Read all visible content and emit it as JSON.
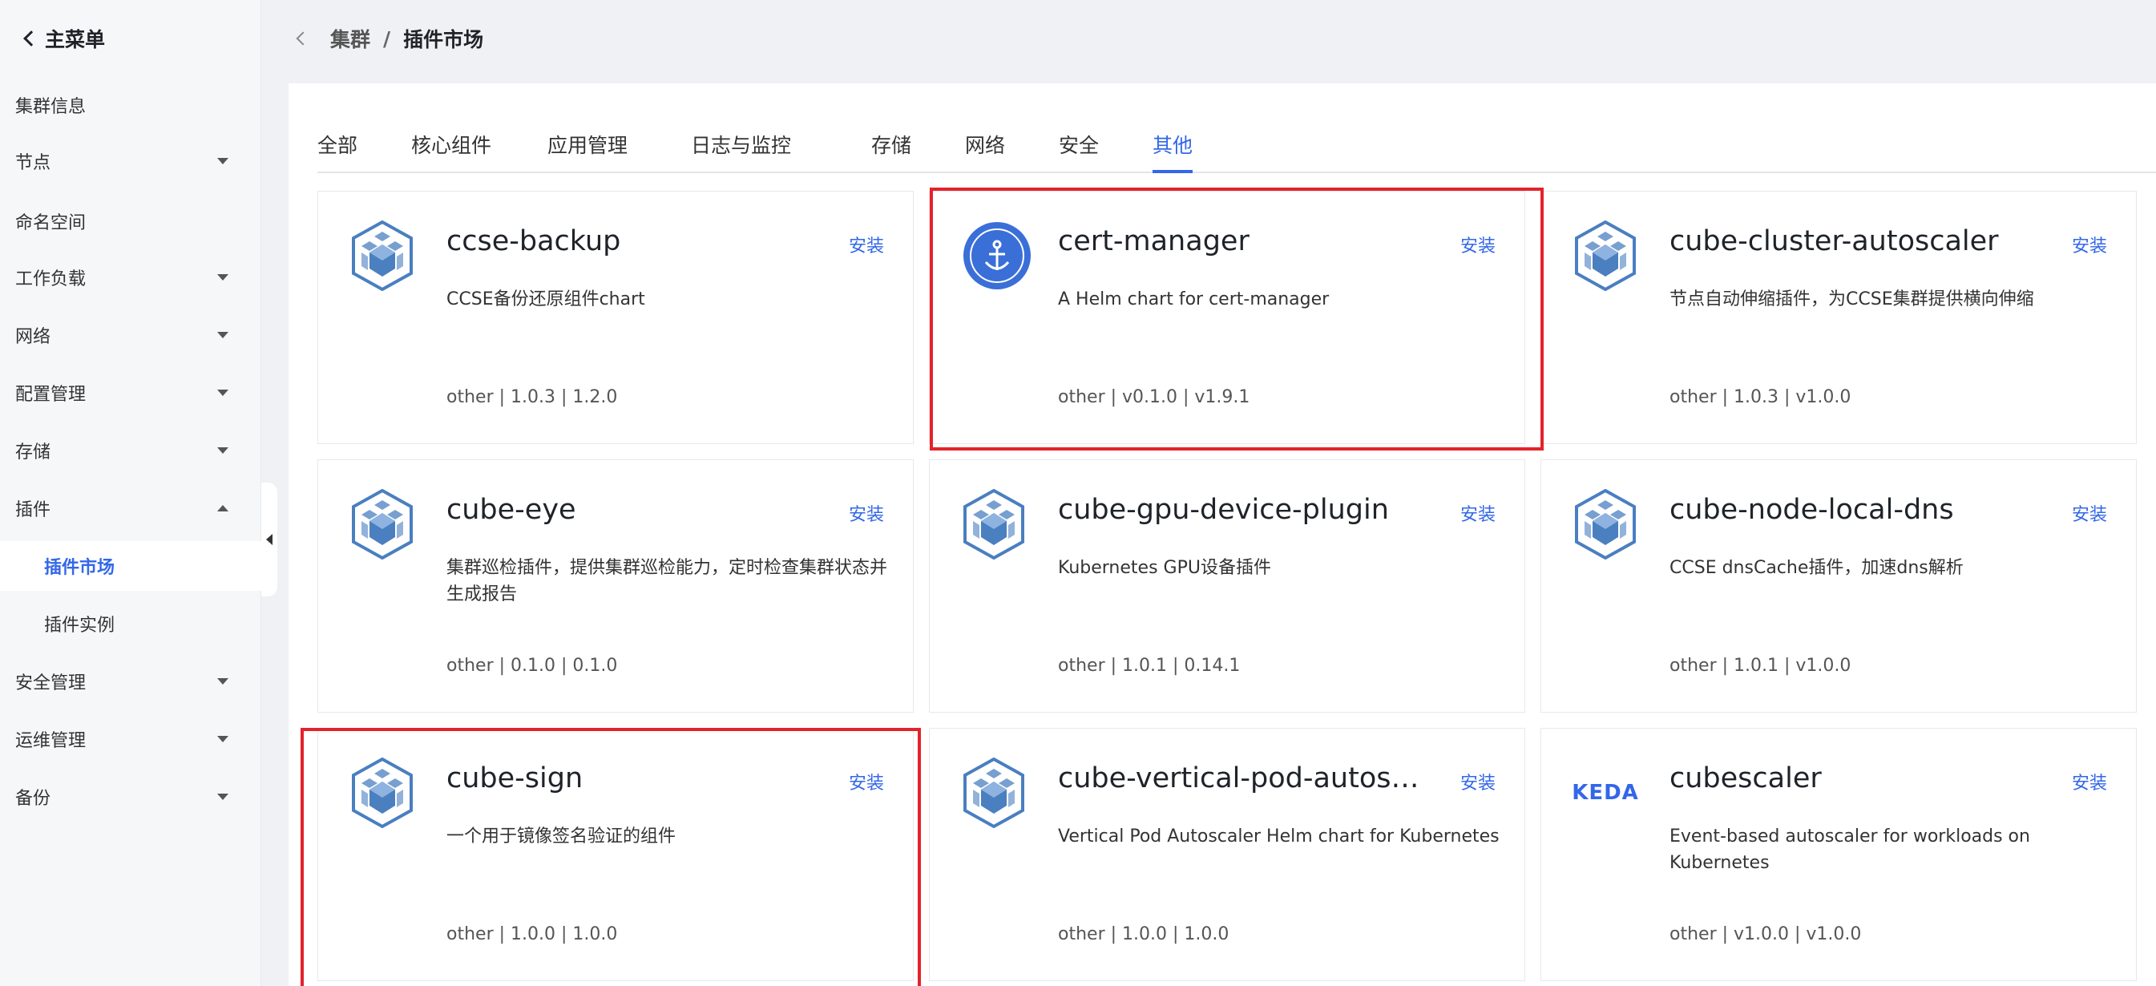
{
  "sidebar": {
    "back_label": "主菜单",
    "items": [
      {
        "label": "集群信息",
        "caret": "none"
      },
      {
        "label": "节点",
        "caret": "down"
      },
      {
        "label": "命名空间",
        "caret": "none"
      },
      {
        "label": "工作负载",
        "caret": "down"
      },
      {
        "label": "网络",
        "caret": "down"
      },
      {
        "label": "配置管理",
        "caret": "down"
      },
      {
        "label": "存储",
        "caret": "down"
      },
      {
        "label": "插件",
        "caret": "up"
      },
      {
        "label": "插件市场",
        "caret": "none",
        "active": true
      },
      {
        "label": "插件实例",
        "caret": "none"
      },
      {
        "label": "安全管理",
        "caret": "down"
      },
      {
        "label": "运维管理",
        "caret": "down"
      },
      {
        "label": "备份",
        "caret": "down"
      }
    ]
  },
  "breadcrumb": {
    "parent": "集群",
    "separator": "/",
    "current": "插件市场"
  },
  "tabs": [
    "全部",
    "核心组件",
    "应用管理",
    "日志与监控",
    "存储",
    "网络",
    "安全",
    "其他"
  ],
  "active_tab": "其他",
  "install_label": "安装",
  "cards": [
    {
      "name": "ccse-backup",
      "desc": "CCSE备份还原组件chart",
      "meta": "other | 1.0.3 | 1.2.0",
      "icon": "cube-icon"
    },
    {
      "name": "cert-manager",
      "desc": "A Helm chart for cert-manager",
      "meta": "other | v0.1.0 | v1.9.1",
      "icon": "cert-manager-icon"
    },
    {
      "name": "cube-cluster-autoscaler",
      "desc": "节点自动伸缩插件，为CCSE集群提供横向伸缩",
      "meta": "other | 1.0.3 | v1.0.0",
      "icon": "cube-icon"
    },
    {
      "name": "cube-eye",
      "desc": "集群巡检插件，提供集群巡检能力，定时检查集群状态并生成报告",
      "meta": "other | 0.1.0 | 0.1.0",
      "icon": "cube-icon"
    },
    {
      "name": "cube-gpu-device-plugin",
      "desc": "Kubernetes GPU设备插件",
      "meta": "other | 1.0.1 | 0.14.1",
      "icon": "cube-icon"
    },
    {
      "name": "cube-node-local-dns",
      "desc": "CCSE dnsCache插件，加速dns解析",
      "meta": "other | 1.0.1 | v1.0.0",
      "icon": "cube-icon"
    },
    {
      "name": "cube-sign",
      "desc": "一个用于镜像签名验证的组件",
      "meta": "other | 1.0.0 | 1.0.0",
      "icon": "cube-icon"
    },
    {
      "name": "cube-vertical-pod-autos…",
      "desc": "Vertical Pod Autoscaler Helm chart for Kubernetes",
      "meta": "other | 1.0.0 | 1.0.0",
      "icon": "cube-icon"
    },
    {
      "name": "cubescaler",
      "desc": "Event-based autoscaler for workloads on Kubernetes",
      "meta": "other | v1.0.0 | v1.0.0",
      "icon": "keda-logo",
      "logo_text": "KEDA"
    }
  ],
  "colors": {
    "accent": "#3367e9",
    "highlight": "#e3232b",
    "cube": "#4a7fc0"
  }
}
